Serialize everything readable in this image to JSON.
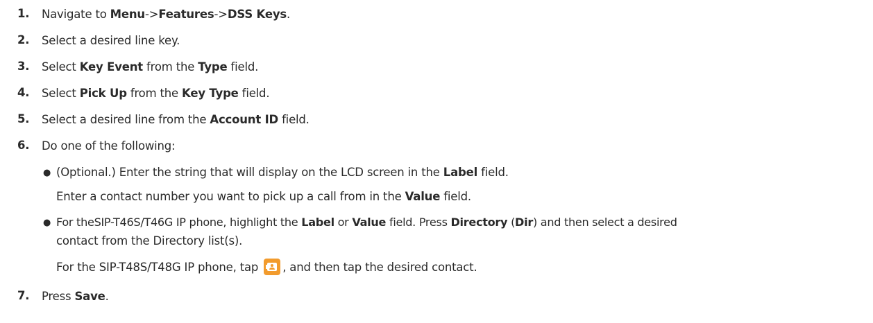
{
  "steps": [
    {
      "num": "1.",
      "p1": "Navigate to ",
      "b1": "Menu",
      "p2": "->",
      "b2": "Features",
      "p3": "->",
      "b3": "DSS Keys",
      "p4": "."
    },
    {
      "num": "2.",
      "p1": "Select a desired line key."
    },
    {
      "num": "3.",
      "p1": "Select ",
      "b1": "Key Event",
      "p2": " from the ",
      "b2": "Type",
      "p3": " field."
    },
    {
      "num": "4.",
      "p1": "Select ",
      "b1": "Pick Up",
      "p2": " from the ",
      "b2": "Key Type",
      "p3": " field."
    },
    {
      "num": "5.",
      "p1": "Select a desired line from the ",
      "b1": "Account ID",
      "p2": " field."
    },
    {
      "num": "6.",
      "p1": "Do one of the following:"
    },
    {
      "num": "7.",
      "p1": "Press ",
      "b1": "Save",
      "p2": "."
    }
  ],
  "bullets": {
    "b1_line1": {
      "p1": "(Optional.) Enter the string that will display on the LCD screen in the ",
      "b1": "Label",
      "p2": " field."
    },
    "b1_line2": {
      "p1": "Enter a contact number you want to pick up a call from in the ",
      "b1": "Value",
      "p2": " field."
    },
    "b2_line1": {
      "p1": "For theSIP-T46S/T46G IP phone, highlight the ",
      "b1": "Label",
      "p2": " or ",
      "b2": "Value",
      "p3": " field. Press ",
      "b3": "Directory",
      "p4": " (",
      "b4": "Dir",
      "p5": ") and then select a desired"
    },
    "b2_line2": {
      "p1": "contact from the Directory list(s)."
    },
    "b2_line3": {
      "p1": "For the SIP-T48S/T48G IP phone, tap ",
      "p2": ", and then tap the desired contact."
    }
  },
  "icons": {
    "contact": "contact-directory-icon",
    "color": "#f29b2d"
  }
}
